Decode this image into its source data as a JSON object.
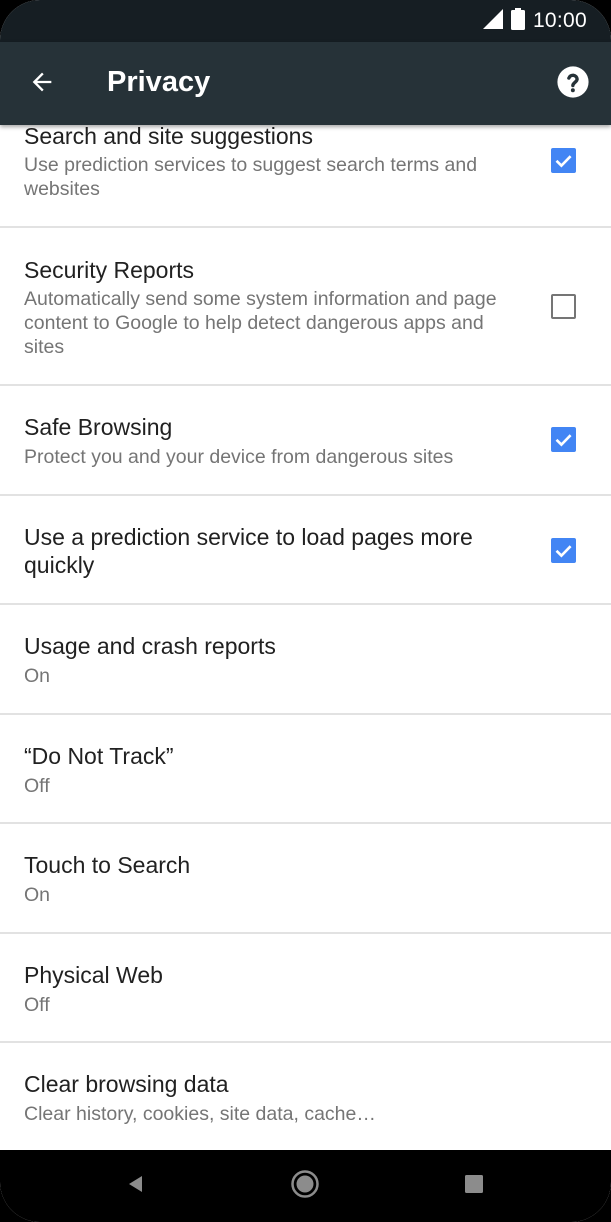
{
  "status_bar": {
    "time": "10:00",
    "icons": [
      "signal-icon",
      "battery-icon"
    ]
  },
  "app_bar": {
    "title": "Privacy",
    "back_icon": "arrow-back-icon",
    "help_icon": "help-icon"
  },
  "settings": [
    {
      "title": "Search and site suggestions",
      "subtitle": "Use prediction services to suggest search terms and websites",
      "checkbox": true
    },
    {
      "title": "Security Reports",
      "subtitle": "Automatically send some system information and page content to Google to help detect dangerous apps and sites",
      "checkbox": false
    },
    {
      "title": "Safe Browsing",
      "subtitle": "Protect you and your device from dangerous sites",
      "checkbox": true
    },
    {
      "title": "Use a prediction service to load pages more quickly",
      "subtitle": "",
      "checkbox": true
    },
    {
      "title": "Usage and crash reports",
      "subtitle": "On"
    },
    {
      "title": "“Do Not Track”",
      "subtitle": "Off"
    },
    {
      "title": "Touch to Search",
      "subtitle": "On"
    },
    {
      "title": "Physical Web",
      "subtitle": "Off"
    },
    {
      "title": "Clear browsing data",
      "subtitle": "Clear history, cookies, site data, cache…"
    }
  ],
  "nav_bar": {
    "icons": [
      "nav-back-icon",
      "nav-home-icon",
      "nav-recents-icon"
    ]
  },
  "colors": {
    "status_bar": "#161e23",
    "app_bar": "#263238",
    "checkbox_on": "#4285f4",
    "divider": "#e2e2e2"
  }
}
